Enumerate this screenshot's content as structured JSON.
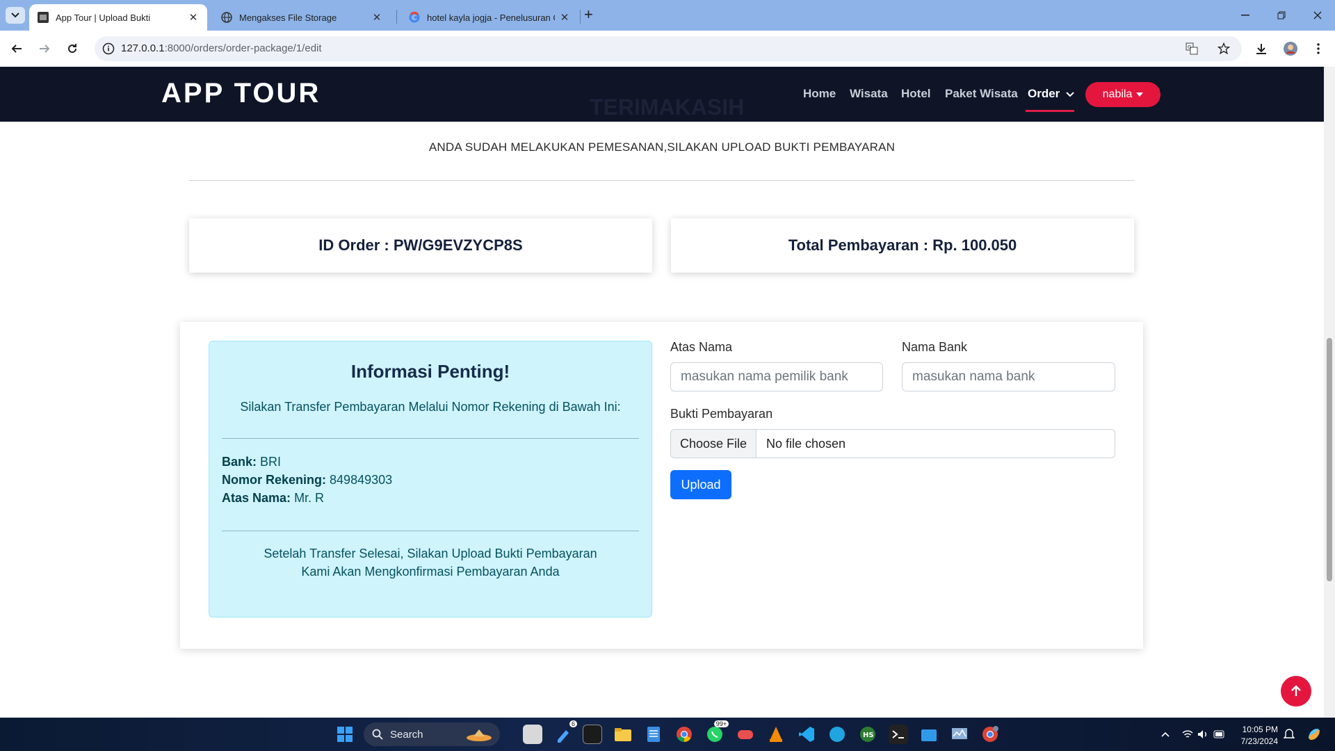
{
  "browser": {
    "tabs": [
      {
        "title": "App Tour | Upload Bukti",
        "active": true
      },
      {
        "title": "Mengakses File Storage",
        "active": false
      },
      {
        "title": "hotel kayla jogja - Penelusuran Go",
        "active": false
      }
    ],
    "url_host": "127.0.0.1",
    "url_path": ":8000/orders/order-package/1/edit"
  },
  "navbar": {
    "brand": "APP TOUR",
    "ghost_title": "TERIMAKASIH",
    "links": [
      "Home",
      "Wisata",
      "Hotel",
      "Paket Wisata",
      "Order"
    ],
    "active_link": "Order",
    "user": "nabila"
  },
  "page": {
    "subtitle": "ANDA SUDAH MELAKUKAN PEMESANAN,SILAKAN UPLOAD BUKTI PEMBAYARAN",
    "order_id_text": "ID Order : PW/G9EVZYCP8S",
    "total_text": "Total Pembayaran : Rp. 100.050"
  },
  "info": {
    "title": "Informasi Penting!",
    "subtitle": "Silakan Transfer Pembayaran Melalui Nomor Rekening di Bawah Ini:",
    "bank_label": "Bank:",
    "bank_value": "BRI",
    "account_label": "Nomor Rekening:",
    "account_value": "849849303",
    "name_label": "Atas Nama:",
    "name_value": "Mr. R",
    "footer_line1": "Setelah Transfer Selesai, Silakan Upload Bukti Pembayaran",
    "footer_line2": "Kami Akan Mengkonfirmasi Pembayaran Anda"
  },
  "form": {
    "atas_nama_label": "Atas Nama",
    "atas_nama_placeholder": "masukan nama pemilik bank",
    "nama_bank_label": "Nama Bank",
    "nama_bank_placeholder": "masukan nama bank",
    "bukti_label": "Bukti Pembayaran",
    "choose_file": "Choose File",
    "no_file": "No file chosen",
    "upload": "Upload"
  },
  "taskbar": {
    "search": "Search",
    "time": "10:05 PM",
    "date": "7/23/2024",
    "badge_a": "6",
    "badge_b": "99+"
  },
  "colors": {
    "navbar_bg": "#0f1527",
    "accent_red": "#e5163e",
    "info_bg": "#cff4fc",
    "primary": "#0d6efd"
  }
}
